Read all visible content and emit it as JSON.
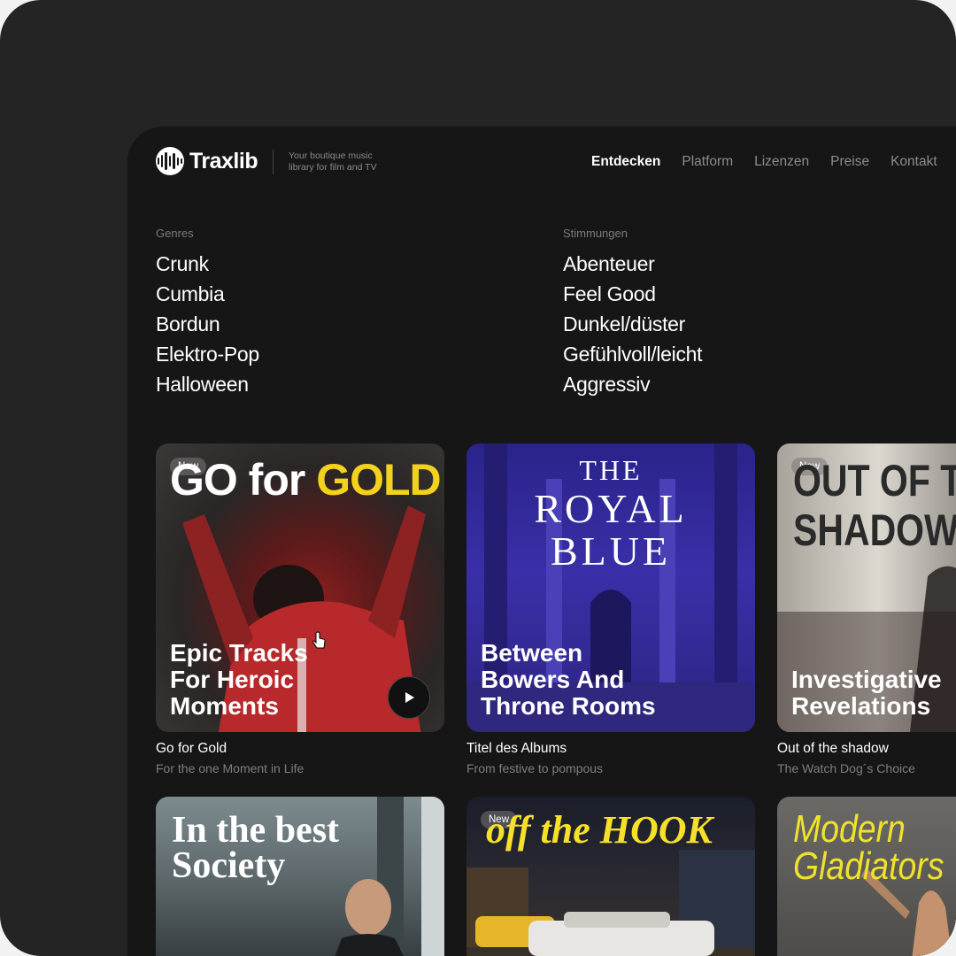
{
  "brand": {
    "name": "Traxlib",
    "tagline": "Your boutique music library for film and TV"
  },
  "nav": {
    "items": [
      "Entdecken",
      "Platform",
      "Lizenzen",
      "Preise",
      "Kontakt"
    ],
    "active": "Entdecken"
  },
  "genres": {
    "heading": "Genres",
    "items": [
      "Crunk",
      "Cumbia",
      "Bordun",
      "Elektro-Pop",
      "Halloween"
    ]
  },
  "moods": {
    "heading": "Stimmungen",
    "items": [
      "Abenteuer",
      "Feel Good",
      "Dunkel/düster",
      "Gefühlvoll/leicht",
      "Aggressiv"
    ]
  },
  "cards": [
    {
      "badge": "New",
      "art_title_a": "GO for ",
      "art_title_b": "GOLD",
      "headline": [
        "Epic Tracks",
        "For Heroic",
        "Moments"
      ],
      "title": "Go for Gold",
      "subtitle": "For the one Moment in Life"
    },
    {
      "badge": "",
      "art_title": [
        "THE",
        "ROYAL",
        "BLUE"
      ],
      "headline": [
        "Between",
        "Bowers And",
        "Throne Rooms"
      ],
      "title": "Titel des Albums",
      "subtitle": "From festive to pompous"
    },
    {
      "badge": "New",
      "art_title": [
        "OUT OF TH",
        "SHADOW"
      ],
      "headline": [
        "Investigative",
        "Revelations"
      ],
      "title": "Out of the shadow",
      "subtitle": "The Watch Dog´s Choice"
    },
    {
      "badge": "",
      "art_title": [
        "In the best",
        "Society"
      ]
    },
    {
      "badge": "New",
      "art_title": [
        "off the HOOK"
      ]
    },
    {
      "badge": "",
      "art_title": [
        "Modern",
        "Gladiators"
      ]
    }
  ],
  "colors": {
    "background": "#242424",
    "screen": "#161616",
    "gold": "#f2d21c",
    "royal_blue": "#3a2fa8",
    "hook_yellow": "#f6e02a"
  },
  "icons": {
    "play": "play-icon",
    "cursor": "hand-cursor-icon"
  }
}
